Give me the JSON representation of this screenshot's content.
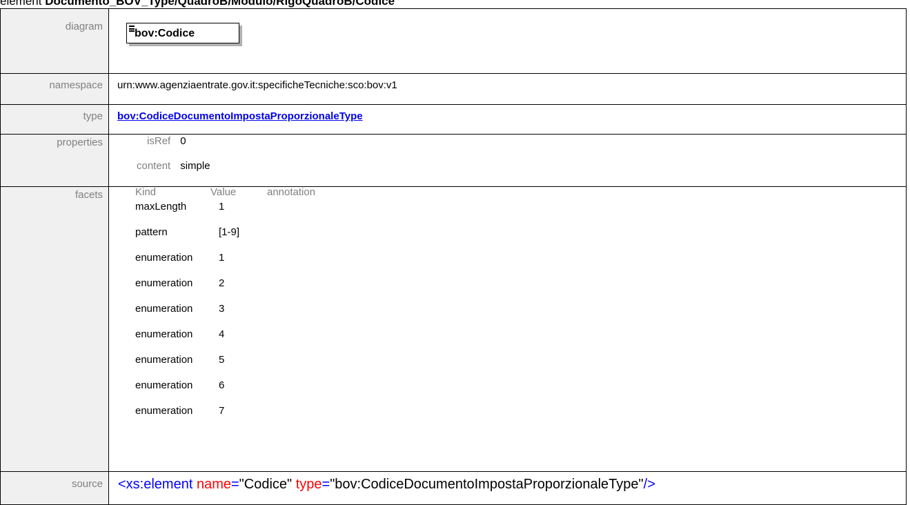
{
  "header": {
    "prefix": "element ",
    "path": "Documento_BOV_Type/QuadroB/Modulo/RigoQuadroB/Codice"
  },
  "rows": {
    "diagram": {
      "label": "diagram",
      "element_name": "bov:Codice"
    },
    "namespace": {
      "label": "namespace",
      "value": "urn:www.agenziaentrate.gov.it:specificheTecniche:sco:bov:v1"
    },
    "type": {
      "label": "type",
      "value": "bov:CodiceDocumentoImpostaProporzionaleType"
    },
    "properties": {
      "label": "properties",
      "items": [
        {
          "key": "isRef",
          "value": "0"
        },
        {
          "key": "content",
          "value": "simple"
        }
      ]
    },
    "facets": {
      "label": "facets",
      "headers": {
        "kind": "Kind",
        "value": "Value",
        "annotation": "annotation"
      },
      "items": [
        {
          "kind": "maxLength",
          "value": "1"
        },
        {
          "kind": "pattern",
          "value": "[1-9]"
        },
        {
          "kind": "enumeration",
          "value": "1"
        },
        {
          "kind": "enumeration",
          "value": "2"
        },
        {
          "kind": "enumeration",
          "value": "3"
        },
        {
          "kind": "enumeration",
          "value": "4"
        },
        {
          "kind": "enumeration",
          "value": "5"
        },
        {
          "kind": "enumeration",
          "value": "6"
        },
        {
          "kind": "enumeration",
          "value": "7"
        }
      ]
    },
    "source": {
      "label": "source",
      "tag_open": "<xs:element",
      "attr1_name": " name",
      "attr1_eq": "=",
      "attr1_value": "\"Codice\"",
      "attr2_name": " type",
      "attr2_eq": "=",
      "attr2_value": "\"bov:CodiceDocumentoImpostaProporzionaleType\"",
      "tag_close": "/>"
    }
  },
  "colors": {
    "label_bg": "#f0f0f0",
    "label_text": "#808080",
    "link": "#0000ee",
    "xml_tag": "#0000ff",
    "xml_attr": "#ff0000"
  }
}
